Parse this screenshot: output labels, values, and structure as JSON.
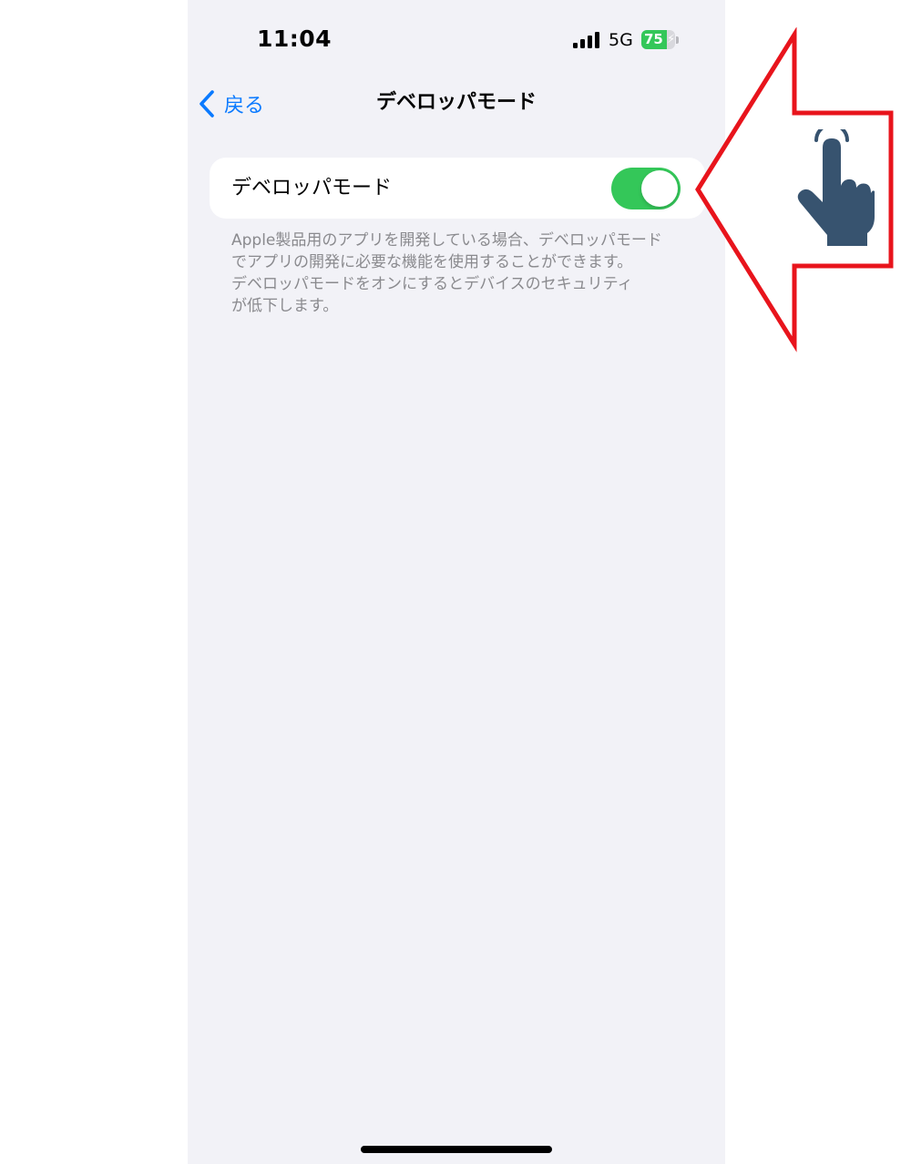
{
  "status_bar": {
    "time": "11:04",
    "network": "5G",
    "battery_percent": "75",
    "battery_level": 0.75,
    "charging": true
  },
  "nav": {
    "back_label": "戻る",
    "title": "デベロッパモード"
  },
  "setting": {
    "label": "デベロッパモード",
    "enabled": true,
    "description": "Apple製品用のアプリを開発している場合、デベロッパモード\nでアプリの開発に必要な機能を使用することができます。\nデベロッパモードをオンにするとデバイスのセキュリティ\nが低下します。"
  },
  "colors": {
    "accent": "#0a7aff",
    "toggle_on": "#34c759",
    "background": "#f2f2f7",
    "annotation_arrow": "#e8141c",
    "hand_icon": "#37536f"
  },
  "icons": {
    "back": "chevron-left-icon",
    "pointer": "tap-hand-icon"
  }
}
